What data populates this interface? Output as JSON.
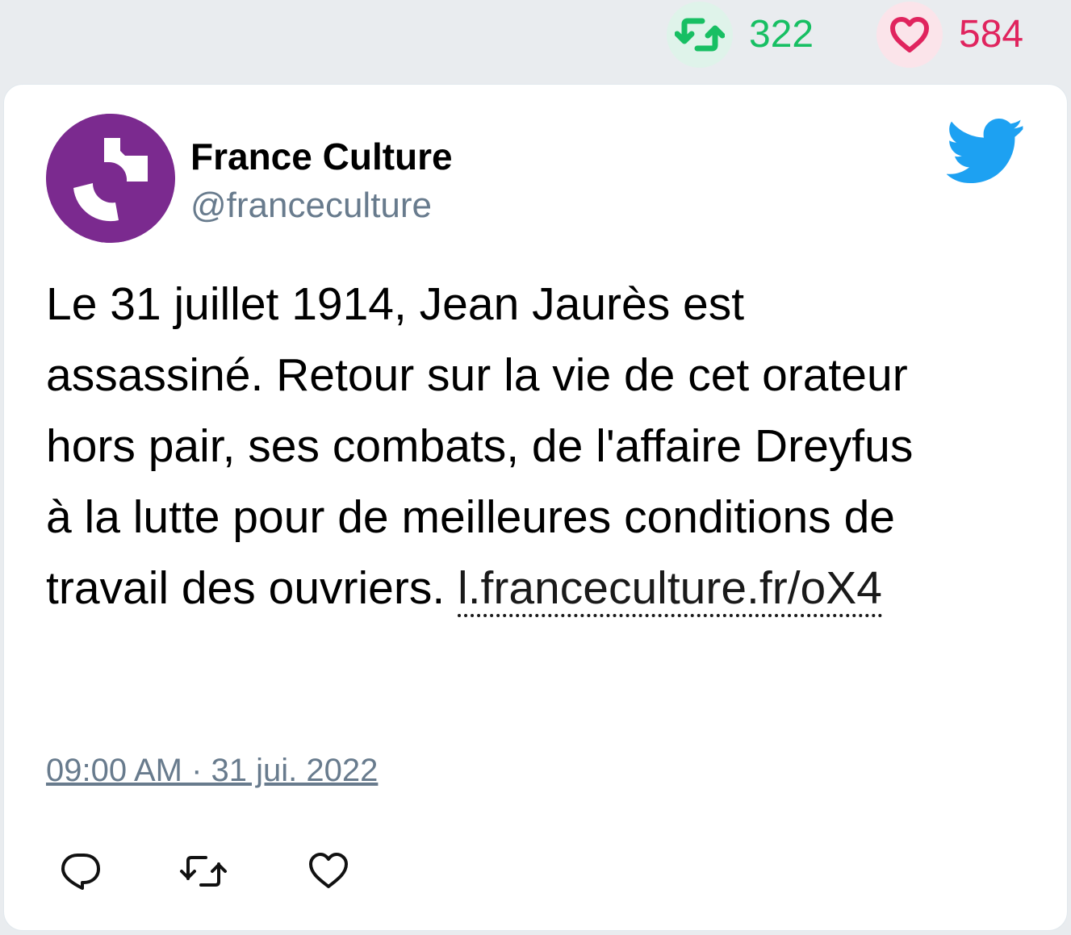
{
  "stats": {
    "retweets": {
      "count": "322",
      "icon": "retweet-icon",
      "color": "#17bf63"
    },
    "likes": {
      "count": "584",
      "icon": "heart-icon",
      "color": "#e0245e"
    }
  },
  "tweet": {
    "author": {
      "name": "France Culture",
      "handle": "@franceculture",
      "avatar_color": "#7b2a8f"
    },
    "brand_icon": "twitter-bird-icon",
    "brand_color": "#1da1f2",
    "text": "Le 31 juillet 1914, Jean Jaurès est assassiné. Retour sur la vie de cet orateur hors pair, ses combats, de l'affaire Dreyfus à la lutte pour de meilleures conditions de travail des ouvriers. ",
    "link": "l.franceculture.fr/oX4",
    "timestamp": "09:00 AM · 31 jui. 2022",
    "actions": [
      {
        "icon": "reply-icon"
      },
      {
        "icon": "retweet-icon"
      },
      {
        "icon": "heart-icon"
      }
    ]
  }
}
